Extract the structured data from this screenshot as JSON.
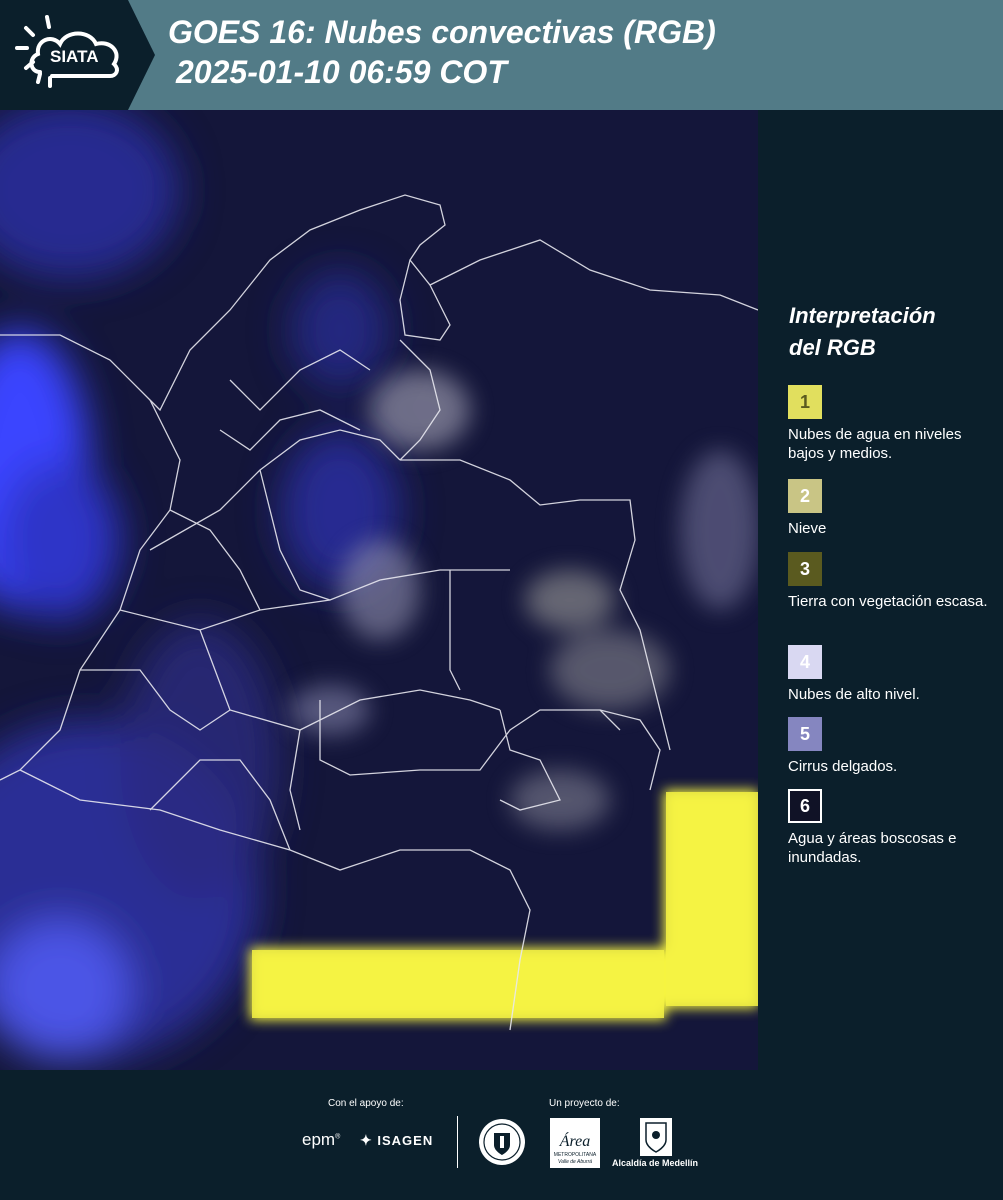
{
  "header": {
    "title_line1": "GOES 16: Nubes convectivas (RGB)",
    "title_line2": "2025-01-10 06:59 COT",
    "logo_text": "SIATA",
    "background": "#527b87"
  },
  "legend": {
    "title_line1": "Interpretación",
    "title_line2": "del RGB",
    "items": [
      {
        "num": "1",
        "label": "Nubes de agua en niveles bajos y medios.",
        "color": "#e1df5e"
      },
      {
        "num": "2",
        "label": "Nieve",
        "color": "#c9c585"
      },
      {
        "num": "3",
        "label": "Tierra con vegetación escasa.",
        "color": "#5a5a1f"
      },
      {
        "num": "4",
        "label": "Nubes de alto nivel.",
        "color": "#d9d8f2"
      },
      {
        "num": "5",
        "label": "Cirrus delgados.",
        "color": "#8586c0"
      },
      {
        "num": "6",
        "label": "Agua y áreas boscosas e inundadas.",
        "color": "#101226"
      }
    ]
  },
  "footer": {
    "support_label": "Con el apoyo de:",
    "project_label": "Un proyecto de:",
    "epm_text": "epm",
    "isagen_text": "ISAGEN",
    "metropolitana_text": "METROPOLITANA",
    "area_text": "Área",
    "valle_text": "Valle de Aburrá",
    "alcaldia_text": "Alcaldía de Medellín"
  }
}
